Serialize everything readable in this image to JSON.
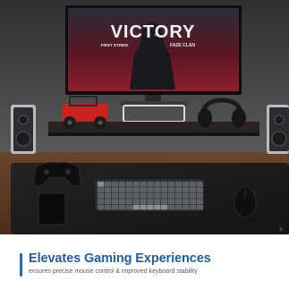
{
  "monitor_screen": {
    "game_title": "VICTORY",
    "sponsor_left": "FIRST STRIKE",
    "sponsor_right": "FAZE CLAN"
  },
  "caption": {
    "headline": "Elevates Gaming Experiences",
    "subline": "ensures precise mouse control & improved keyboard stability"
  },
  "colors": {
    "accent": "#1e6fb8",
    "headline": "#1f5f9e",
    "subline": "#555b63",
    "desk_mat": "#1b1b1d",
    "wall": "#4a4b4d",
    "desk_wood": "#5b3a24"
  },
  "icons": [
    "brand-logo-icon"
  ]
}
